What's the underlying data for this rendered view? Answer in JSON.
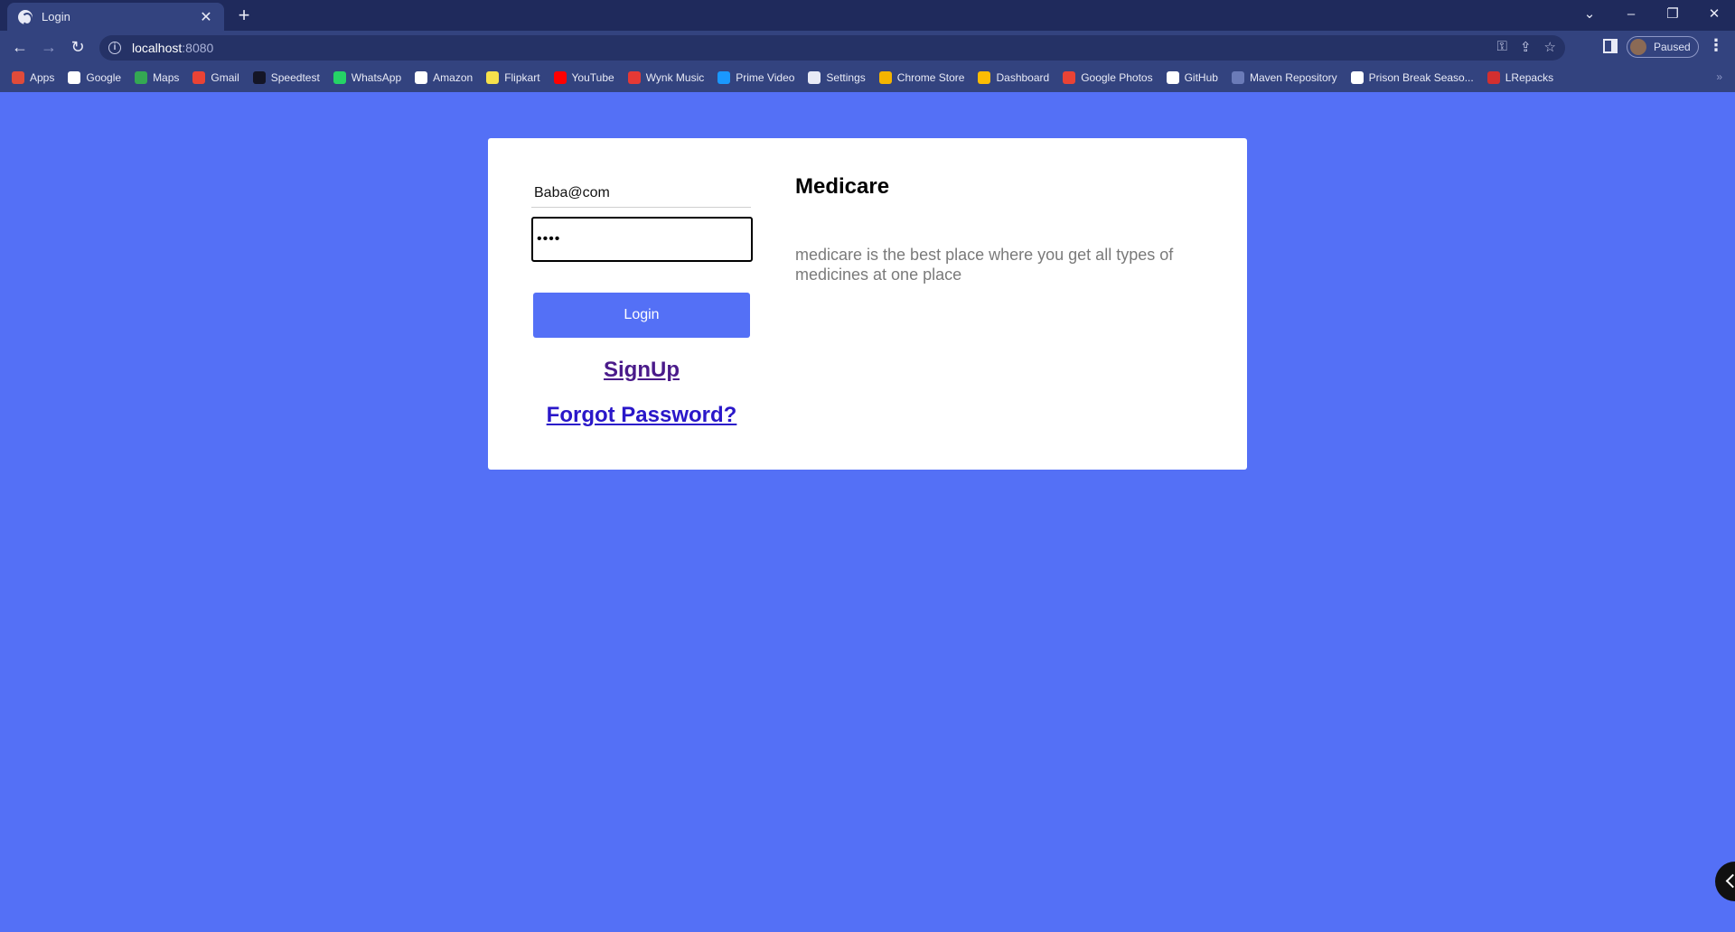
{
  "browser": {
    "tab_title": "Login",
    "tab_close": "✕",
    "new_tab": "+",
    "url_host": "localhost",
    "url_port": ":8080",
    "profile_status": "Paused",
    "bookmarks": [
      {
        "label": "Apps",
        "icon": "apps-grid-icon",
        "color": "#e04b3a"
      },
      {
        "label": "Google",
        "icon": "google-icon",
        "color": "#ffffff"
      },
      {
        "label": "Maps",
        "icon": "maps-icon",
        "color": "#34a853"
      },
      {
        "label": "Gmail",
        "icon": "gmail-icon",
        "color": "#ea4335"
      },
      {
        "label": "Speedtest",
        "icon": "speedtest-icon",
        "color": "#141526"
      },
      {
        "label": "WhatsApp",
        "icon": "whatsapp-icon",
        "color": "#25d366"
      },
      {
        "label": "Amazon",
        "icon": "amazon-icon",
        "color": "#ffffff"
      },
      {
        "label": "Flipkart",
        "icon": "flipkart-icon",
        "color": "#f7e14b"
      },
      {
        "label": "YouTube",
        "icon": "youtube-icon",
        "color": "#ff0000"
      },
      {
        "label": "Wynk Music",
        "icon": "wynk-icon",
        "color": "#e53935"
      },
      {
        "label": "Prime Video",
        "icon": "prime-video-icon",
        "color": "#1a98ff"
      },
      {
        "label": "Settings",
        "icon": "settings-gear-icon",
        "color": "#e8eaf6"
      },
      {
        "label": "Chrome Store",
        "icon": "chrome-store-icon",
        "color": "#f4b400"
      },
      {
        "label": "Dashboard",
        "icon": "dashboard-icon",
        "color": "#fbbc04"
      },
      {
        "label": "Google Photos",
        "icon": "google-photos-icon",
        "color": "#ea4335"
      },
      {
        "label": "GitHub",
        "icon": "github-icon",
        "color": "#ffffff"
      },
      {
        "label": "Maven Repository",
        "icon": "maven-icon",
        "color": "#6b7bb8"
      },
      {
        "label": "Prison Break Seaso...",
        "icon": "wordpress-icon",
        "color": "#ffffff"
      },
      {
        "label": "LRepacks",
        "icon": "lrepacks-icon",
        "color": "#d32f2f"
      }
    ],
    "bookmarks_more": "»"
  },
  "login": {
    "email_value": "Baba@com",
    "password_value": "....",
    "login_label": "Login",
    "signup_label": "SignUp",
    "forgot_label": "Forgot Password?"
  },
  "brand": {
    "title": "Medicare",
    "description": "medicare is the best place where you get all types of medicines at one place"
  },
  "colors": {
    "page_background": "#5470f6",
    "button": "#5470f6",
    "card": "#ffffff"
  }
}
